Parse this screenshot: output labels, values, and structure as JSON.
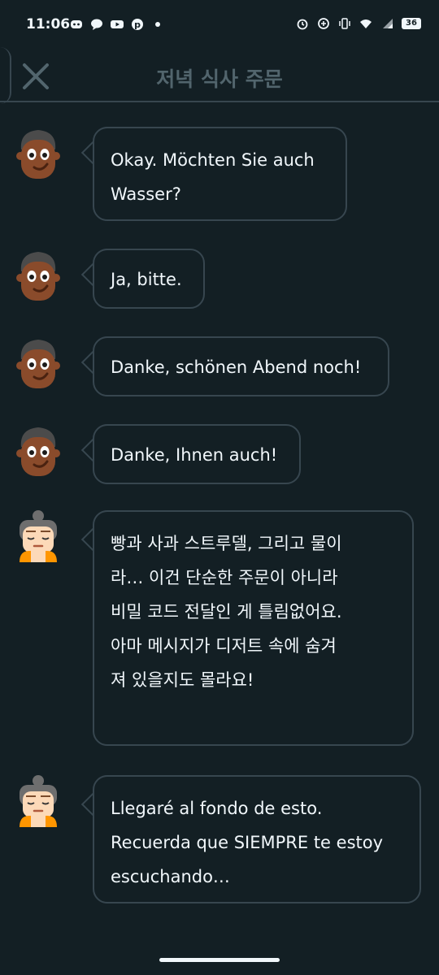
{
  "status_bar": {
    "time": "11:06",
    "left_icons": [
      "discord-icon",
      "chat-icon",
      "youtube-icon",
      "pinterest-icon",
      "dot-icon"
    ],
    "right_icons": [
      "alarm-icon",
      "data-saver-icon",
      "vibrate-icon",
      "wifi-icon",
      "signal-icon"
    ],
    "battery": "36"
  },
  "header": {
    "title": "저녁 식사 주문",
    "close_icon": "close-icon"
  },
  "messages": [
    {
      "speaker": "man",
      "text_line1": "Okay. Möchten Sie auch",
      "text_line2": "Wasser?"
    },
    {
      "speaker": "man",
      "text": "Ja, bitte."
    },
    {
      "speaker": "man",
      "text": "Danke, schönen Abend noch!"
    },
    {
      "speaker": "man",
      "text": "Danke, Ihnen auch!"
    },
    {
      "speaker": "woman",
      "lines": [
        "빵과 사과 스트루델, 그리고 물이",
        "라… 이건 단순한 주문이 아니라",
        "비밀 코드 전달인 게 틀림없어요.",
        "아마 메시지가 디저트 속에 숨겨",
        "져 있을지도 몰라요!"
      ]
    },
    {
      "speaker": "woman",
      "lines": [
        "Llegaré al fondo de esto.",
        "Recuerda que SIEMPRE te estoy",
        "escuchando…"
      ]
    }
  ],
  "colors": {
    "background": "#131f24",
    "bubble_border": "#37464f",
    "title": "#52656d",
    "text": "#f1f7fb"
  }
}
